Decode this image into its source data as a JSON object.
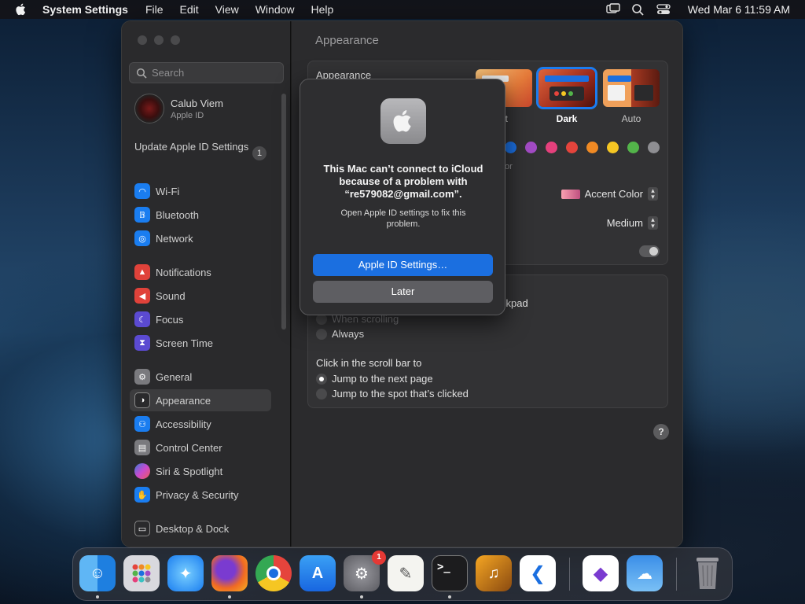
{
  "menubar": {
    "app_name": "System Settings",
    "items": [
      "File",
      "Edit",
      "View",
      "Window",
      "Help"
    ],
    "clock": "Wed Mar 6  11:59 AM"
  },
  "sidebar": {
    "search_placeholder": "Search",
    "account_name": "Calub Viem",
    "account_sub": "Apple ID",
    "update_label": "Update Apple ID Settings",
    "update_badge": "1",
    "items": [
      {
        "label": "Wi-Fi",
        "icon": "wifi-icon",
        "color": "#1a7df0"
      },
      {
        "label": "Bluetooth",
        "icon": "bluetooth-icon",
        "color": "#1a7df0"
      },
      {
        "label": "Network",
        "icon": "globe-icon",
        "color": "#1a7df0"
      },
      {
        "label": "Notifications",
        "icon": "bell-icon",
        "color": "#e0423a"
      },
      {
        "label": "Sound",
        "icon": "speaker-icon",
        "color": "#e0423a"
      },
      {
        "label": "Focus",
        "icon": "moon-icon",
        "color": "#5b4ad1"
      },
      {
        "label": "Screen Time",
        "icon": "hourglass-icon",
        "color": "#5b4ad1"
      },
      {
        "label": "General",
        "icon": "gear-icon",
        "color": "#7a7a7e"
      },
      {
        "label": "Appearance",
        "icon": "appearance-icon",
        "color": "#2a2a2c"
      },
      {
        "label": "Accessibility",
        "icon": "accessibility-icon",
        "color": "#1a7df0"
      },
      {
        "label": "Control Center",
        "icon": "control-center-icon",
        "color": "#7a7a7e"
      },
      {
        "label": "Siri & Spotlight",
        "icon": "siri-icon",
        "color": "#8a44d0"
      },
      {
        "label": "Privacy & Security",
        "icon": "hand-icon",
        "color": "#1a7df0"
      },
      {
        "label": "Desktop & Dock",
        "icon": "dock-icon",
        "color": "#2a2a2c"
      }
    ]
  },
  "main": {
    "title": "Appearance",
    "appearance_label": "Appearance",
    "themes": [
      {
        "label": "nt"
      },
      {
        "label": "Dark"
      },
      {
        "label": "Auto"
      }
    ],
    "accent_fragment": "or",
    "accent_colors": [
      "#1b6fe0",
      "#a24bc4",
      "#e5407c",
      "#e5443c",
      "#f08a24",
      "#f5c623",
      "#53b44a",
      "#8e8e92"
    ],
    "highlight_value": "Accent Color",
    "sidebar_icon_size_value": "Medium",
    "scroll_fragment": "ckpad",
    "show_scroll_bars": {
      "options": [
        "When scrolling",
        "Always"
      ]
    },
    "click_scroll_label": "Click in the scroll bar to",
    "click_scroll_options": [
      "Jump to the next page",
      "Jump to the spot that’s clicked"
    ],
    "help": "?"
  },
  "alert": {
    "headline": "This Mac can’t connect to iCloud because of a problem with “re579082@gmail.com”.",
    "body": "Open Apple ID settings to fix this problem.",
    "primary_button": "Apple ID Settings…",
    "secondary_button": "Later"
  },
  "dock": {
    "badge": "1",
    "apps": [
      "Finder",
      "Launchpad",
      "Safari",
      "Firefox",
      "Chrome",
      "App Store",
      "System Settings",
      "TextEdit",
      "Terminal",
      "GarageBand",
      "VS Code",
      "Visual Studio",
      "Weather",
      "Trash"
    ]
  }
}
